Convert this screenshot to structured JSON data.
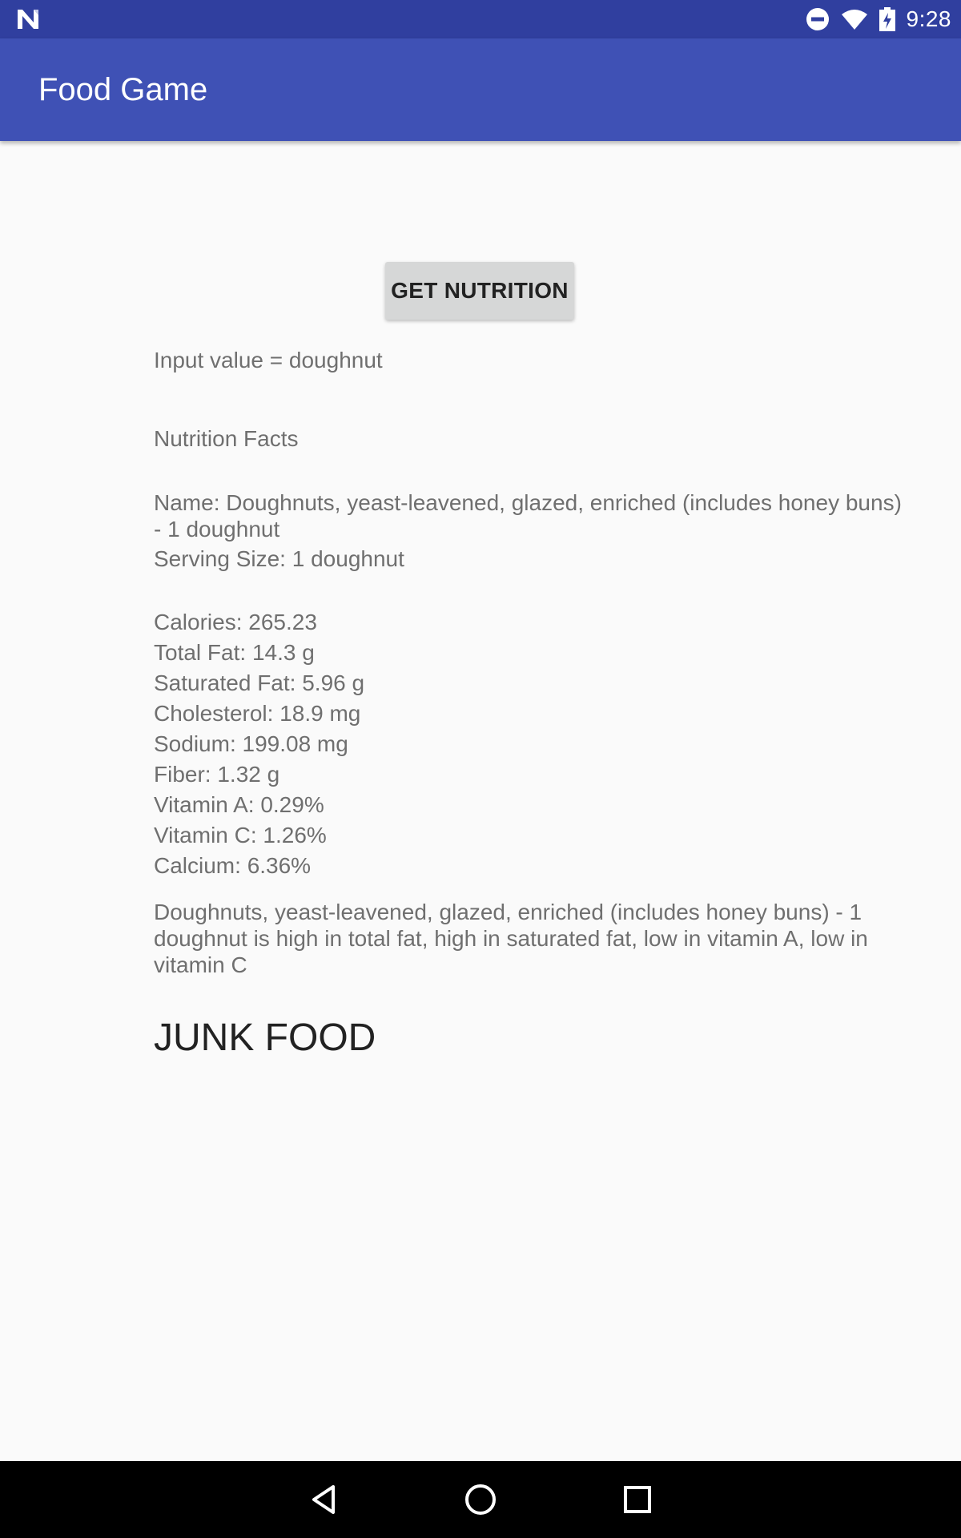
{
  "status_bar": {
    "time": "9:28",
    "icons": [
      "n-logo-icon",
      "do-not-disturb-icon",
      "wifi-icon",
      "battery-charging-icon"
    ]
  },
  "app_bar": {
    "title": "Food Game",
    "color": "#3f51b5"
  },
  "main": {
    "button_label": "GET NUTRITION",
    "input_value": "Input value = doughnut",
    "section_title": "Nutrition Facts",
    "name_line": "Name: Doughnuts, yeast-leavened, glazed, enriched (includes honey buns) - 1 doughnut",
    "serving_size": "Serving Size: 1 doughnut",
    "nutrients": [
      "Calories: 265.23",
      "Total Fat: 14.3 g",
      "Saturated Fat: 5.96 g",
      "Cholesterol: 18.9 mg",
      "Sodium: 199.08 mg",
      "Fiber: 1.32 g",
      "Vitamin A: 0.29%",
      "Vitamin C: 1.26%",
      "Calcium: 6.36%"
    ],
    "summary": "Doughnuts, yeast-leavened, glazed, enriched (includes honey buns) - 1 doughnut is high in total fat, high in saturated fat, low in vitamin A, low in vitamin C",
    "verdict": "JUNK FOOD"
  },
  "nav_bar": {
    "icons": [
      "back-icon",
      "home-icon",
      "recents-icon"
    ]
  }
}
